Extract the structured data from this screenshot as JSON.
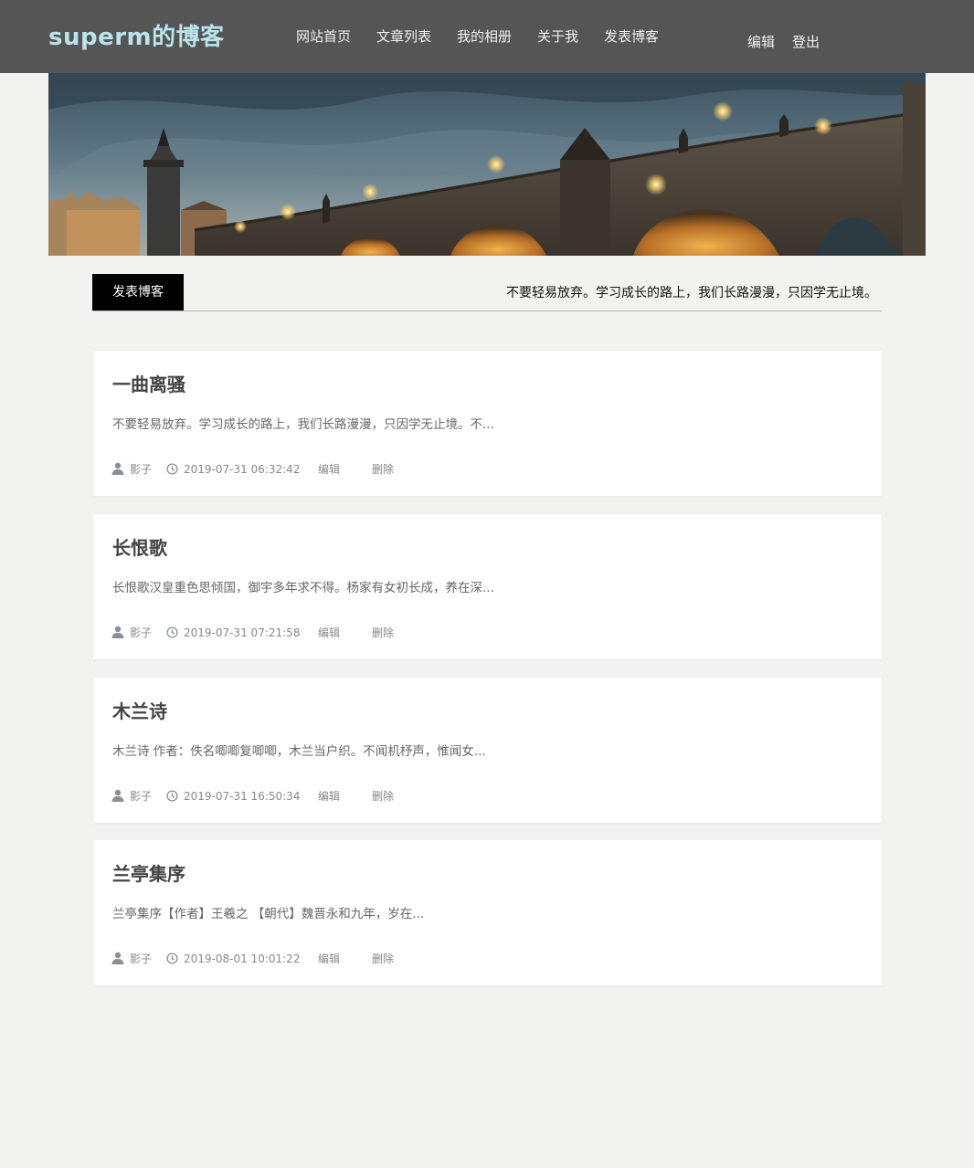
{
  "header": {
    "site_title": "superm的博客",
    "nav": [
      "网站首页",
      "文章列表",
      "我的相册",
      "关于我",
      "发表博客"
    ],
    "user_links": [
      "编辑",
      "登出"
    ]
  },
  "section": {
    "tab_label": "发表博客",
    "motto": "不要轻易放弃。学习成长的路上，我们长路漫漫，只因学无止境。"
  },
  "posts": [
    {
      "title": "一曲离骚",
      "excerpt": "不要轻易放弃。学习成长的路上，我们长路漫漫，只因学无止境。不...",
      "author": "影子",
      "date": "2019-07-31 06:32:42",
      "edit": "编辑",
      "delete": "删除"
    },
    {
      "title": "长恨歌",
      "excerpt": "长恨歌汉皇重色思倾国，御宇多年求不得。杨家有女初长成，养在深...",
      "author": "影子",
      "date": "2019-07-31 07:21:58",
      "edit": "编辑",
      "delete": "删除"
    },
    {
      "title": "木兰诗",
      "excerpt": "木兰诗 作者：佚名唧唧复唧唧，木兰当户织。不闻机杼声，惟闻女...",
      "author": "影子",
      "date": "2019-07-31 16:50:34",
      "edit": "编辑",
      "delete": "删除"
    },
    {
      "title": "兰亭集序",
      "excerpt": "兰亭集序【作者】王羲之 【朝代】魏晋永和九年，岁在...",
      "author": "影子",
      "date": "2019-08-01 10:01:22",
      "edit": "编辑",
      "delete": "删除"
    }
  ],
  "colors": {
    "topbar": "#555555",
    "brand": "#b9e4ec",
    "page_bg": "#f2f2f0",
    "tab_bg": "#000000",
    "card_bg": "#ffffff"
  },
  "icons": {
    "author": "user-icon",
    "date": "clock-icon"
  }
}
